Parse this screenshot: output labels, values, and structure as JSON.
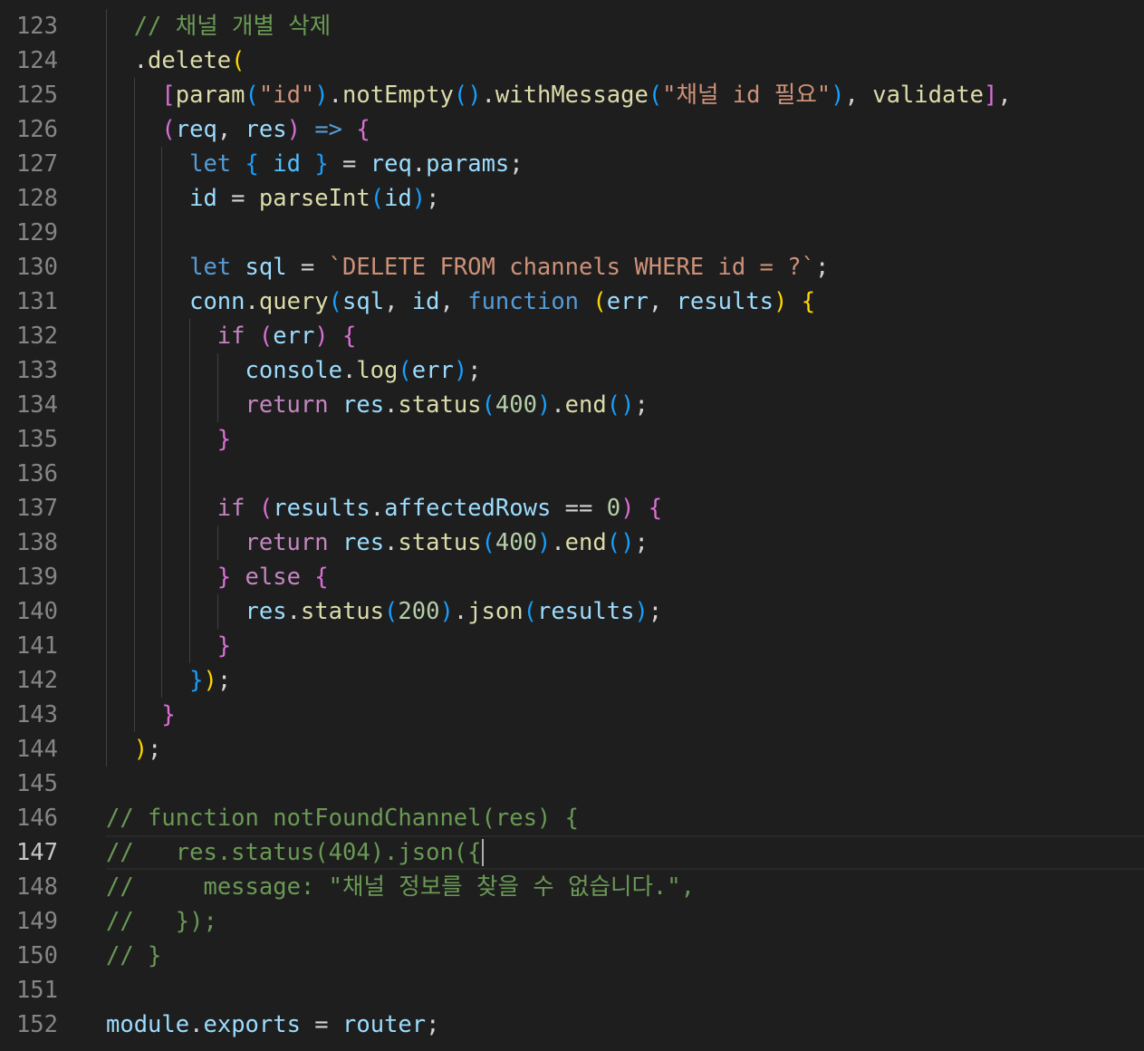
{
  "editor": {
    "current_line": 147,
    "lines": [
      {
        "number": "123",
        "indent": 1,
        "tokens": [
          [
            "comment",
            "// 채널 개별 삭제"
          ]
        ]
      },
      {
        "number": "124",
        "indent": 1,
        "tokens": [
          [
            "plain",
            "."
          ],
          [
            "func",
            "delete"
          ],
          [
            "b1",
            "("
          ]
        ]
      },
      {
        "number": "125",
        "indent": 2,
        "tokens": [
          [
            "b2",
            "["
          ],
          [
            "func",
            "param"
          ],
          [
            "b3",
            "("
          ],
          [
            "string",
            "\"id\""
          ],
          [
            "b3",
            ")"
          ],
          [
            "plain",
            "."
          ],
          [
            "func",
            "notEmpty"
          ],
          [
            "b3",
            "()"
          ],
          [
            "plain",
            "."
          ],
          [
            "func",
            "withMessage"
          ],
          [
            "b3",
            "("
          ],
          [
            "string",
            "\"채널 id 필요\""
          ],
          [
            "b3",
            ")"
          ],
          [
            "plain",
            ", "
          ],
          [
            "func",
            "validate"
          ],
          [
            "b2",
            "]"
          ],
          [
            "plain",
            ","
          ]
        ]
      },
      {
        "number": "126",
        "indent": 2,
        "tokens": [
          [
            "b2",
            "("
          ],
          [
            "var",
            "req"
          ],
          [
            "plain",
            ", "
          ],
          [
            "var",
            "res"
          ],
          [
            "b2",
            ")"
          ],
          [
            "plain",
            " "
          ],
          [
            "keyword",
            "=>"
          ],
          [
            "plain",
            " "
          ],
          [
            "b2",
            "{"
          ]
        ]
      },
      {
        "number": "127",
        "indent": 3,
        "tokens": [
          [
            "keyword",
            "let"
          ],
          [
            "plain",
            " "
          ],
          [
            "b3",
            "{"
          ],
          [
            "plain",
            " "
          ],
          [
            "const",
            "id"
          ],
          [
            "plain",
            " "
          ],
          [
            "b3",
            "}"
          ],
          [
            "plain",
            " = "
          ],
          [
            "var",
            "req"
          ],
          [
            "plain",
            "."
          ],
          [
            "var",
            "params"
          ],
          [
            "plain",
            ";"
          ]
        ]
      },
      {
        "number": "128",
        "indent": 3,
        "tokens": [
          [
            "var",
            "id"
          ],
          [
            "plain",
            " = "
          ],
          [
            "func",
            "parseInt"
          ],
          [
            "b3",
            "("
          ],
          [
            "var",
            "id"
          ],
          [
            "b3",
            ")"
          ],
          [
            "plain",
            ";"
          ]
        ]
      },
      {
        "number": "129",
        "indent": 3,
        "tokens": []
      },
      {
        "number": "130",
        "indent": 3,
        "tokens": [
          [
            "keyword",
            "let"
          ],
          [
            "plain",
            " "
          ],
          [
            "var",
            "sql"
          ],
          [
            "plain",
            " = "
          ],
          [
            "string",
            "`DELETE FROM channels WHERE id = ?`"
          ],
          [
            "plain",
            ";"
          ]
        ]
      },
      {
        "number": "131",
        "indent": 3,
        "tokens": [
          [
            "var",
            "conn"
          ],
          [
            "plain",
            "."
          ],
          [
            "func",
            "query"
          ],
          [
            "b3",
            "("
          ],
          [
            "var",
            "sql"
          ],
          [
            "plain",
            ", "
          ],
          [
            "var",
            "id"
          ],
          [
            "plain",
            ", "
          ],
          [
            "keyword",
            "function"
          ],
          [
            "plain",
            " "
          ],
          [
            "b1",
            "("
          ],
          [
            "var",
            "err"
          ],
          [
            "plain",
            ", "
          ],
          [
            "var",
            "results"
          ],
          [
            "b1",
            ")"
          ],
          [
            "plain",
            " "
          ],
          [
            "b1",
            "{"
          ]
        ]
      },
      {
        "number": "132",
        "indent": 4,
        "tokens": [
          [
            "control",
            "if"
          ],
          [
            "plain",
            " "
          ],
          [
            "b2",
            "("
          ],
          [
            "var",
            "err"
          ],
          [
            "b2",
            ")"
          ],
          [
            "plain",
            " "
          ],
          [
            "b2",
            "{"
          ]
        ]
      },
      {
        "number": "133",
        "indent": 5,
        "tokens": [
          [
            "var",
            "console"
          ],
          [
            "plain",
            "."
          ],
          [
            "func",
            "log"
          ],
          [
            "b3",
            "("
          ],
          [
            "var",
            "err"
          ],
          [
            "b3",
            ")"
          ],
          [
            "plain",
            ";"
          ]
        ]
      },
      {
        "number": "134",
        "indent": 5,
        "tokens": [
          [
            "control",
            "return"
          ],
          [
            "plain",
            " "
          ],
          [
            "var",
            "res"
          ],
          [
            "plain",
            "."
          ],
          [
            "func",
            "status"
          ],
          [
            "b3",
            "("
          ],
          [
            "number",
            "400"
          ],
          [
            "b3",
            ")"
          ],
          [
            "plain",
            "."
          ],
          [
            "func",
            "end"
          ],
          [
            "b3",
            "()"
          ],
          [
            "plain",
            ";"
          ]
        ]
      },
      {
        "number": "135",
        "indent": 4,
        "tokens": [
          [
            "b2",
            "}"
          ]
        ]
      },
      {
        "number": "136",
        "indent": 4,
        "tokens": []
      },
      {
        "number": "137",
        "indent": 4,
        "tokens": [
          [
            "control",
            "if"
          ],
          [
            "plain",
            " "
          ],
          [
            "b2",
            "("
          ],
          [
            "var",
            "results"
          ],
          [
            "plain",
            "."
          ],
          [
            "var",
            "affectedRows"
          ],
          [
            "plain",
            " == "
          ],
          [
            "number",
            "0"
          ],
          [
            "b2",
            ")"
          ],
          [
            "plain",
            " "
          ],
          [
            "b2",
            "{"
          ]
        ]
      },
      {
        "number": "138",
        "indent": 5,
        "tokens": [
          [
            "control",
            "return"
          ],
          [
            "plain",
            " "
          ],
          [
            "var",
            "res"
          ],
          [
            "plain",
            "."
          ],
          [
            "func",
            "status"
          ],
          [
            "b3",
            "("
          ],
          [
            "number",
            "400"
          ],
          [
            "b3",
            ")"
          ],
          [
            "plain",
            "."
          ],
          [
            "func",
            "end"
          ],
          [
            "b3",
            "()"
          ],
          [
            "plain",
            ";"
          ]
        ]
      },
      {
        "number": "139",
        "indent": 4,
        "tokens": [
          [
            "b2",
            "}"
          ],
          [
            "plain",
            " "
          ],
          [
            "control",
            "else"
          ],
          [
            "plain",
            " "
          ],
          [
            "b2",
            "{"
          ]
        ]
      },
      {
        "number": "140",
        "indent": 5,
        "tokens": [
          [
            "var",
            "res"
          ],
          [
            "plain",
            "."
          ],
          [
            "func",
            "status"
          ],
          [
            "b3",
            "("
          ],
          [
            "number",
            "200"
          ],
          [
            "b3",
            ")"
          ],
          [
            "plain",
            "."
          ],
          [
            "func",
            "json"
          ],
          [
            "b3",
            "("
          ],
          [
            "var",
            "results"
          ],
          [
            "b3",
            ")"
          ],
          [
            "plain",
            ";"
          ]
        ]
      },
      {
        "number": "141",
        "indent": 4,
        "tokens": [
          [
            "b2",
            "}"
          ]
        ]
      },
      {
        "number": "142",
        "indent": 3,
        "tokens": [
          [
            "b3",
            "}"
          ],
          [
            "b1",
            ")"
          ],
          [
            "plain",
            ";"
          ]
        ]
      },
      {
        "number": "143",
        "indent": 2,
        "tokens": [
          [
            "b2",
            "}"
          ]
        ]
      },
      {
        "number": "144",
        "indent": 1,
        "tokens": [
          [
            "b1",
            ")"
          ],
          [
            "plain",
            ";"
          ]
        ]
      },
      {
        "number": "145",
        "indent": 0,
        "tokens": []
      },
      {
        "number": "146",
        "indent": 0,
        "tokens": [
          [
            "comment",
            "// function notFoundChannel(res) {"
          ]
        ]
      },
      {
        "number": "147",
        "indent": 0,
        "tokens": [
          [
            "comment",
            "//   res.status(404).json({"
          ]
        ]
      },
      {
        "number": "148",
        "indent": 0,
        "tokens": [
          [
            "comment",
            "//     message: \"채널 정보를 찾을 수 없습니다.\","
          ]
        ]
      },
      {
        "number": "149",
        "indent": 0,
        "tokens": [
          [
            "comment",
            "//   });"
          ]
        ]
      },
      {
        "number": "150",
        "indent": 0,
        "tokens": [
          [
            "comment",
            "// }"
          ]
        ]
      },
      {
        "number": "151",
        "indent": 0,
        "tokens": []
      },
      {
        "number": "152",
        "indent": 0,
        "tokens": [
          [
            "var",
            "module"
          ],
          [
            "plain",
            "."
          ],
          [
            "var",
            "exports"
          ],
          [
            "plain",
            " = "
          ],
          [
            "var",
            "router"
          ],
          [
            "plain",
            ";"
          ]
        ]
      }
    ]
  }
}
